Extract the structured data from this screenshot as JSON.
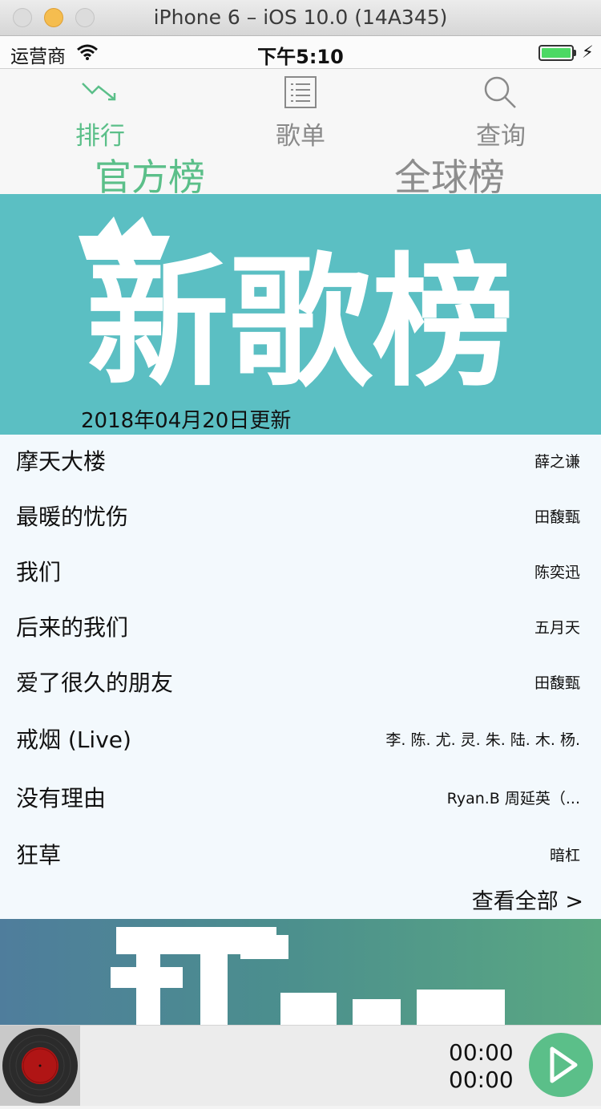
{
  "window": {
    "title": "iPhone 6 – iOS 10.0 (14A345)"
  },
  "status_bar": {
    "carrier": "运营商",
    "time": "下午5:10",
    "battery_level": 1.0,
    "wifi_icon": "wifi-icon",
    "charging_icon": "bolt-icon"
  },
  "tabs": [
    {
      "label": "排行",
      "icon": "trend-down-icon",
      "active": true
    },
    {
      "label": "歌单",
      "icon": "list-icon",
      "active": false
    },
    {
      "label": "查询",
      "icon": "search-icon",
      "active": false
    }
  ],
  "sub_tabs": [
    {
      "label": "官方榜",
      "active": true
    },
    {
      "label": "全球榜",
      "active": false
    }
  ],
  "banner": {
    "logo_text": "新歌榜",
    "update_text": "2018年04月20日更新"
  },
  "songs": [
    {
      "title": "摩天大楼",
      "artist": "薛之谦"
    },
    {
      "title": "最暖的忧伤",
      "artist": "田馥甄"
    },
    {
      "title": "我们",
      "artist": "陈奕迅"
    },
    {
      "title": "后来的我们",
      "artist": "五月天"
    },
    {
      "title": "爱了很久的朋友",
      "artist": "田馥甄"
    },
    {
      "title": "戒烟 (Live)",
      "artist": "李. 陈. 尤. 灵. 朱. 陆. 木. 杨."
    },
    {
      "title": "没有理由",
      "artist": "Ryan.B   周延英（..."
    },
    {
      "title": "狂草",
      "artist": "暗杠"
    }
  ],
  "view_all": "查看全部 >",
  "player": {
    "elapsed": "00:00",
    "total": "00:00",
    "play_icon": "play-icon",
    "disc_icon": "vinyl-disc-icon"
  },
  "colors": {
    "accent": "#5bbf89",
    "banner": "#5bbfc3",
    "inactive": "#8a8a8a"
  }
}
